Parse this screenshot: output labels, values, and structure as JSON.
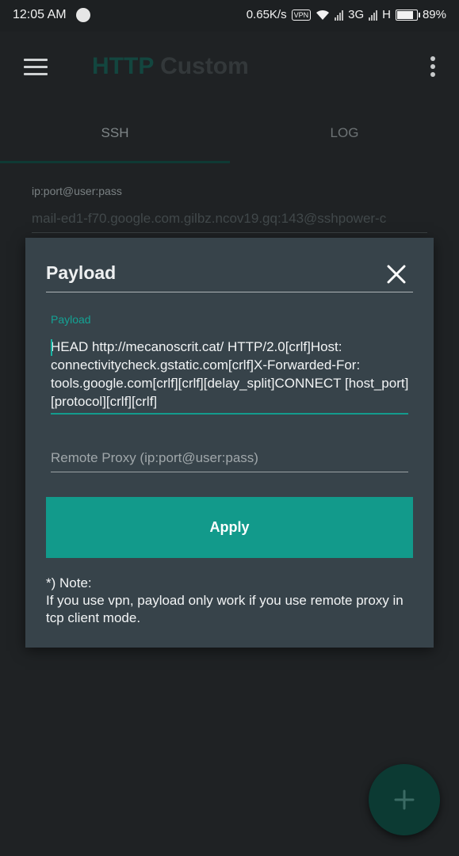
{
  "status_bar": {
    "time": "12:05 AM",
    "net_speed": "0.65K/s",
    "vpn": "VPN",
    "network_3g": "3G",
    "network_h": "H",
    "battery": "89%",
    "battery_level": 0.89
  },
  "appbar": {
    "title_part1": "HTTP",
    "title_part2": "Custom"
  },
  "tabs": [
    {
      "label": "SSH",
      "active": true
    },
    {
      "label": "LOG",
      "active": false
    }
  ],
  "background_form": {
    "label": "ip:port@user:pass",
    "value": "mail-ed1-f70.google.com.gilbz.ncov19.gq:143@sshpower-c"
  },
  "dialog": {
    "title": "Payload",
    "payload_label": "Payload",
    "payload_value": "HEAD http://mecanoscrit.cat/ HTTP/2.0[crlf]Host: connectivitycheck.gstatic.com[crlf]X-Forwarded-For: tools.google.com[crlf][crlf][delay_split]CONNECT [host_port] [protocol][crlf][crlf]",
    "remote_proxy_placeholder": "Remote Proxy (ip:port@user:pass)",
    "apply_label": "Apply",
    "note_title": "*) Note:",
    "note_body": "If you use vpn, payload only work if you use remote proxy in tcp client mode."
  },
  "colors": {
    "accent": "#129a8b",
    "dialog_bg": "#37434a",
    "page_bg": "#1f2224"
  },
  "icons": {
    "menu": "hamburger-icon",
    "overflow": "kebab-icon",
    "close": "close-icon",
    "fab": "plus-icon"
  }
}
